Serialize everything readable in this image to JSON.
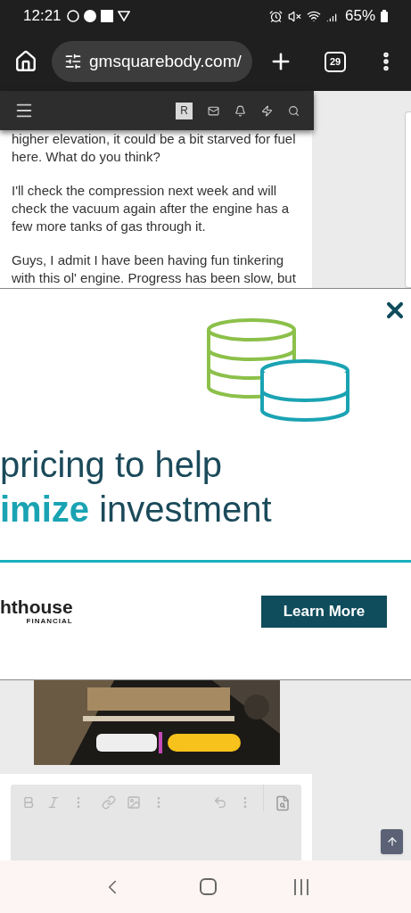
{
  "status_bar": {
    "time": "12:21",
    "battery": "65%"
  },
  "browser": {
    "url": "gmsquarebody.com/",
    "tab_count": "29"
  },
  "site_header": {
    "avatar_letter": "R"
  },
  "post": {
    "paragraphs": [
      "higher elevation, it could be a bit starved for fuel here. What do you think?",
      "I'll check the compression next week and will check the vacuum again after the engine has a few more tanks of gas through it.",
      "Guys, I admit I have been having fun tinkering with this ol' engine. Progress has been slow, but"
    ]
  },
  "ad": {
    "headline_1": "pricing to help",
    "headline_2": "**imize** investment",
    "brand": "hthouse",
    "brand_sub": "FINANCIAL",
    "button": "Learn More"
  }
}
